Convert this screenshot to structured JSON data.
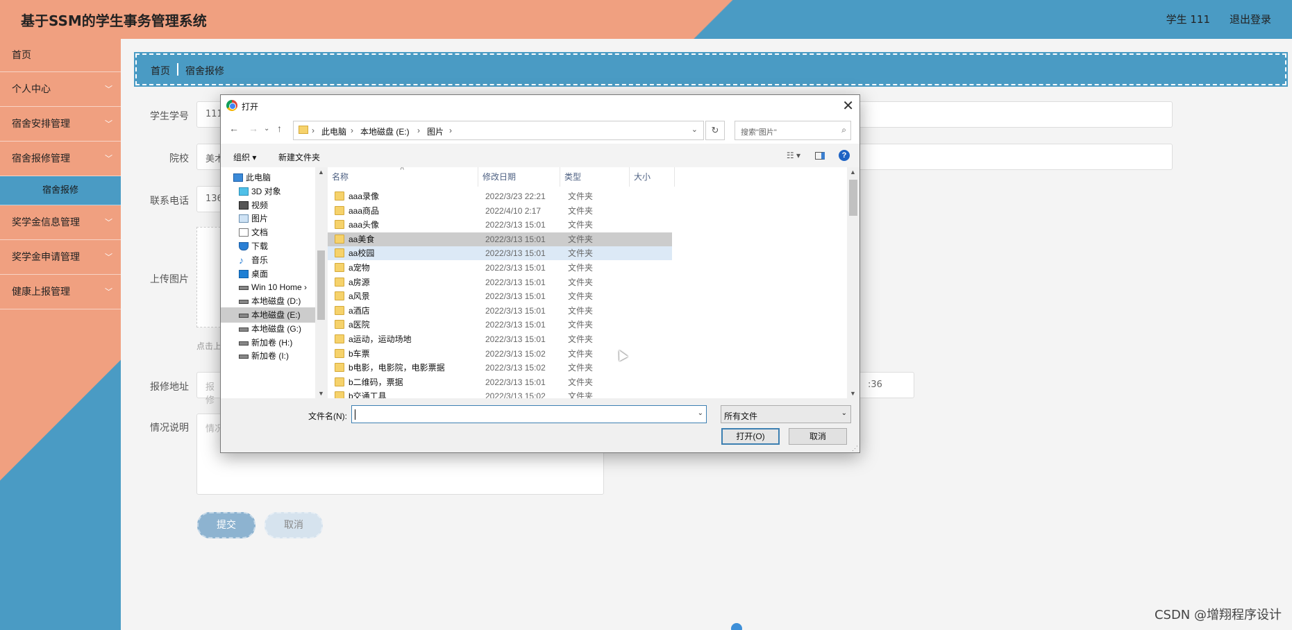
{
  "header": {
    "title": "基于SSM的学生事务管理系统",
    "user": "学生 111",
    "logout": "退出登录"
  },
  "sidebar": {
    "items": [
      {
        "label": "首页"
      },
      {
        "label": "个人中心"
      },
      {
        "label": "宿舍安排管理"
      },
      {
        "label": "宿舍报修管理"
      }
    ],
    "sub_item": "宿舍报修",
    "items_after": [
      {
        "label": "奖学金信息管理"
      },
      {
        "label": "奖学金申请管理"
      },
      {
        "label": "健康上报管理"
      }
    ]
  },
  "breadcrumb": {
    "home": "首页",
    "current": "宿舍报修"
  },
  "form": {
    "student_id_label": "学生学号",
    "student_id_value": "111",
    "school_label": "院校",
    "school_value": "美术",
    "phone_label": "联系电话",
    "phone_value": "136",
    "upload_label": "上传图片",
    "upload_hint": "点击上",
    "address_label": "报修地址",
    "address_placeholder": "报修",
    "time_value": ":36",
    "desc_label": "情况说明",
    "desc_placeholder": "情况",
    "submit": "提交",
    "cancel": "取消"
  },
  "dialog": {
    "title": "打开",
    "path": [
      "此电脑",
      "本地磁盘 (E:)",
      "图片"
    ],
    "search_placeholder": "搜索\"图片\"",
    "organize": "组织 ▾",
    "new_folder": "新建文件夹",
    "tree": [
      {
        "label": "此电脑",
        "icon": "computer"
      },
      {
        "label": "3D 对象",
        "icon": "cube"
      },
      {
        "label": "视频",
        "icon": "video"
      },
      {
        "label": "图片",
        "icon": "picture"
      },
      {
        "label": "文档",
        "icon": "document"
      },
      {
        "label": "下载",
        "icon": "download"
      },
      {
        "label": "音乐",
        "icon": "music"
      },
      {
        "label": "桌面",
        "icon": "desktop"
      },
      {
        "label": "Win 10 Home ›",
        "icon": "drive"
      },
      {
        "label": "本地磁盘 (D:)",
        "icon": "drive"
      },
      {
        "label": "本地磁盘 (E:)",
        "icon": "drive",
        "selected": true
      },
      {
        "label": "本地磁盘 (G:)",
        "icon": "drive"
      },
      {
        "label": "新加卷 (H:)",
        "icon": "drive"
      },
      {
        "label": "新加卷 (I:)",
        "icon": "drive"
      }
    ],
    "columns": [
      "名称",
      "修改日期",
      "类型",
      "大小"
    ],
    "rows": [
      {
        "name": "aaa录像",
        "date": "2022/3/23 22:21",
        "type": "文件夹"
      },
      {
        "name": "aaa商品",
        "date": "2022/4/10 2:17",
        "type": "文件夹"
      },
      {
        "name": "aaa头像",
        "date": "2022/3/13 15:01",
        "type": "文件夹"
      },
      {
        "name": "aa美食",
        "date": "2022/3/13 15:01",
        "type": "文件夹",
        "state": "selected"
      },
      {
        "name": "aa校园",
        "date": "2022/3/13 15:01",
        "type": "文件夹",
        "state": "hover"
      },
      {
        "name": "a宠物",
        "date": "2022/3/13 15:01",
        "type": "文件夹"
      },
      {
        "name": "a房源",
        "date": "2022/3/13 15:01",
        "type": "文件夹"
      },
      {
        "name": "a风景",
        "date": "2022/3/13 15:01",
        "type": "文件夹"
      },
      {
        "name": "a酒店",
        "date": "2022/3/13 15:01",
        "type": "文件夹"
      },
      {
        "name": "a医院",
        "date": "2022/3/13 15:01",
        "type": "文件夹"
      },
      {
        "name": "a运动，运动场地",
        "date": "2022/3/13 15:01",
        "type": "文件夹"
      },
      {
        "name": "b车票",
        "date": "2022/3/13 15:02",
        "type": "文件夹"
      },
      {
        "name": "b电影，电影院，电影票据",
        "date": "2022/3/13 15:02",
        "type": "文件夹"
      },
      {
        "name": "b二维码，票据",
        "date": "2022/3/13 15:01",
        "type": "文件夹"
      },
      {
        "name": "b交通工具",
        "date": "2022/3/13 15:02",
        "type": "文件夹"
      }
    ],
    "filename_label": "文件名(N):",
    "filename_value": "",
    "filetype": "所有文件",
    "open": "打开(O)",
    "cancel": "取消"
  },
  "watermark": "CSDN @增翔程序设计"
}
